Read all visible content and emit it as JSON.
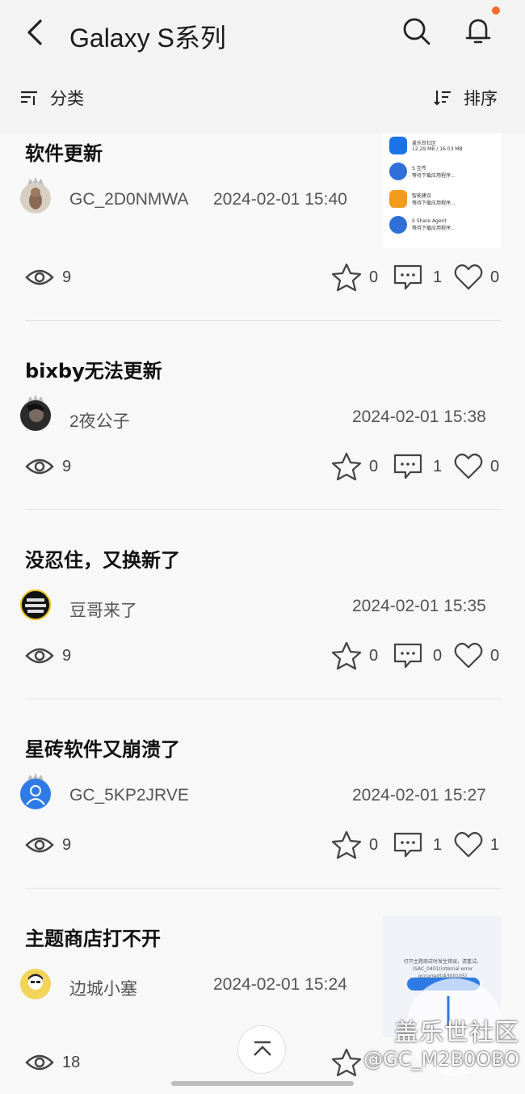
{
  "header": {
    "title": "Galaxy S系列",
    "filter_label": "分类",
    "sort_label": "排序",
    "notification_dot_color": "#f56a2b"
  },
  "posts": [
    {
      "title": "软件更新",
      "author": "GC_2D0NMWA",
      "date": "2024-02-01 15:40",
      "views": "9",
      "stars": "0",
      "comments": "1",
      "likes": "0",
      "thumbnail_items": [
        {
          "name": "盖乐世社区",
          "status": "12.29 MB / 16.03 MB",
          "color": "#1a73e8"
        },
        {
          "name": "S 互传",
          "status": "等待下载应用程序...",
          "color": "#2e6fd8"
        },
        {
          "name": "智能建议",
          "status": "等待下载应用程序...",
          "color": "#f29b1d"
        },
        {
          "name": "S Share Agent",
          "status": "等待下载应用程序...",
          "color": "#2e6fd8"
        }
      ]
    },
    {
      "title": "bixby无法更新",
      "author": "2夜公子",
      "date": "2024-02-01 15:38",
      "views": "9",
      "stars": "0",
      "comments": "1",
      "likes": "0"
    },
    {
      "title": "没忍住，又换新了",
      "author": "豆哥来了",
      "date": "2024-02-01 15:35",
      "views": "9",
      "stars": "0",
      "comments": "0",
      "likes": "0"
    },
    {
      "title": "星砖软件又崩溃了",
      "author": "GC_5KP2JRVE",
      "date": "2024-02-01 15:27",
      "views": "9",
      "stars": "0",
      "comments": "1",
      "likes": "1"
    },
    {
      "title": "主题商店打不开",
      "author": "边城小塞",
      "date": "2024-02-01 15:24",
      "views": "18",
      "thumbnail_text": "打开主题商店时发生错误，请重试。(SAC_0401(internal error occurred)/A300105)"
    }
  ],
  "watermark": {
    "line1": "盖乐世社区",
    "line2": "@GC_M2B0OBO"
  }
}
